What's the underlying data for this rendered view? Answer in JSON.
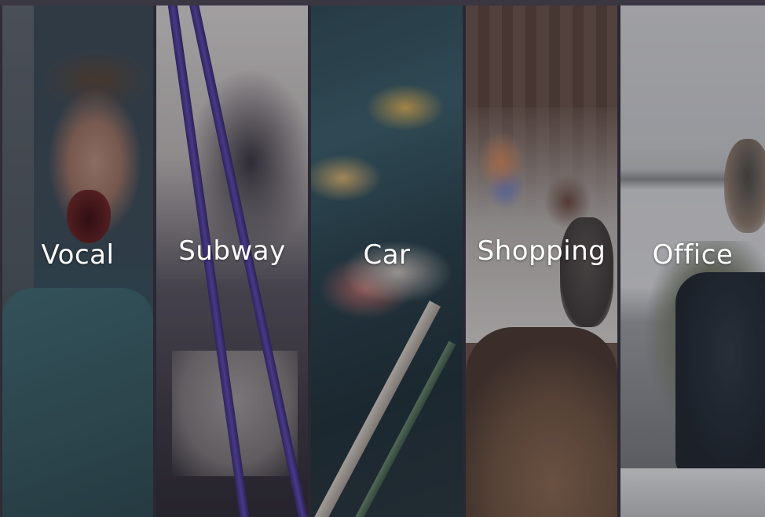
{
  "panels": [
    {
      "id": "vocal",
      "label": "Vocal"
    },
    {
      "id": "subway",
      "label": "Subway"
    },
    {
      "id": "car",
      "label": "Car"
    },
    {
      "id": "shopping",
      "label": "Shopping"
    },
    {
      "id": "office",
      "label": "Office"
    }
  ]
}
